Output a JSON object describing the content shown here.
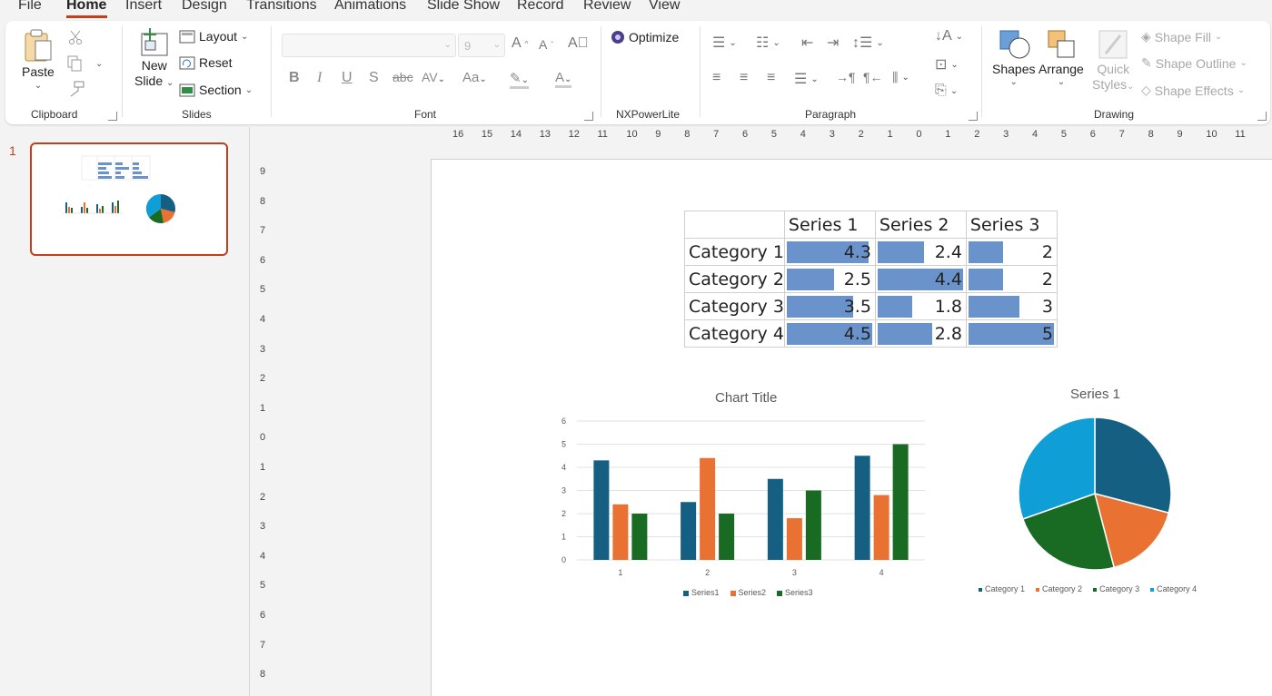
{
  "menu": {
    "tabs": [
      "File",
      "Home",
      "Insert",
      "Design",
      "Transitions",
      "Animations",
      "Slide Show",
      "Record",
      "Review",
      "View"
    ],
    "active": "Home"
  },
  "ribbon": {
    "clipboard": {
      "paste": "Paste",
      "label": "Clipboard"
    },
    "slides": {
      "new_slide_line1": "New",
      "new_slide_line2": "Slide",
      "layout": "Layout",
      "reset": "Reset",
      "section": "Section",
      "label": "Slides"
    },
    "font": {
      "size_placeholder": "9",
      "label": "Font"
    },
    "nxpowerlite": {
      "optimize": "Optimize",
      "label": "NXPowerLite"
    },
    "paragraph": {
      "label": "Paragraph"
    },
    "drawing": {
      "shapes": "Shapes",
      "arrange": "Arrange",
      "quick_line1": "Quick",
      "quick_line2": "Styles",
      "shape_fill": "Shape Fill",
      "shape_outline": "Shape Outline",
      "shape_effects": "Shape Effects",
      "label": "Drawing"
    }
  },
  "slide_panel": {
    "slide_number": "1"
  },
  "rulers": {
    "horizontal": [
      "16",
      "15",
      "14",
      "13",
      "12",
      "11",
      "10",
      "9",
      "8",
      "7",
      "6",
      "5",
      "4",
      "3",
      "2",
      "1",
      "0",
      "1",
      "2",
      "3",
      "4",
      "5",
      "6",
      "7",
      "8",
      "9",
      "10",
      "11"
    ],
    "vertical": [
      "9",
      "8",
      "7",
      "6",
      "5",
      "4",
      "3",
      "2",
      "1",
      "0",
      "1",
      "2",
      "3",
      "4",
      "5",
      "6",
      "7",
      "8"
    ]
  },
  "table": {
    "headers": [
      "",
      "Series 1",
      "Series 2",
      "Series 3"
    ],
    "rows": [
      {
        "category": "Category 1",
        "values": [
          "4.3",
          "2.4",
          "2"
        ]
      },
      {
        "category": "Category 2",
        "values": [
          "2.5",
          "4.4",
          "2"
        ]
      },
      {
        "category": "Category 3",
        "values": [
          "3.5",
          "1.8",
          "3"
        ]
      },
      {
        "category": "Category 4",
        "values": [
          "4.5",
          "2.8",
          "5"
        ]
      }
    ]
  },
  "colors": {
    "accent": "#c43e1c",
    "series1": "#156082",
    "series2": "#e97132",
    "series3": "#196b24",
    "series4": "#0f9ed5",
    "databar": "#6a93cc"
  },
  "chart_data": [
    {
      "type": "bar",
      "title": "Chart Title",
      "categories": [
        "1",
        "2",
        "3",
        "4"
      ],
      "series": [
        {
          "name": "Series1",
          "values": [
            4.3,
            2.5,
            3.5,
            4.5
          ]
        },
        {
          "name": "Series2",
          "values": [
            2.4,
            4.4,
            1.8,
            2.8
          ]
        },
        {
          "name": "Series3",
          "values": [
            2,
            2,
            3,
            5
          ]
        }
      ],
      "yticks": [
        "0",
        "1",
        "2",
        "3",
        "4",
        "5",
        "6"
      ],
      "ylim": [
        0,
        6
      ],
      "grid": true,
      "legend": "bottom"
    },
    {
      "type": "pie",
      "title": "Series 1",
      "labels": [
        "Category 1",
        "Category 2",
        "Category 3",
        "Category 4"
      ],
      "values": [
        4.3,
        2.5,
        3.5,
        4.5
      ],
      "legend": "bottom"
    }
  ]
}
